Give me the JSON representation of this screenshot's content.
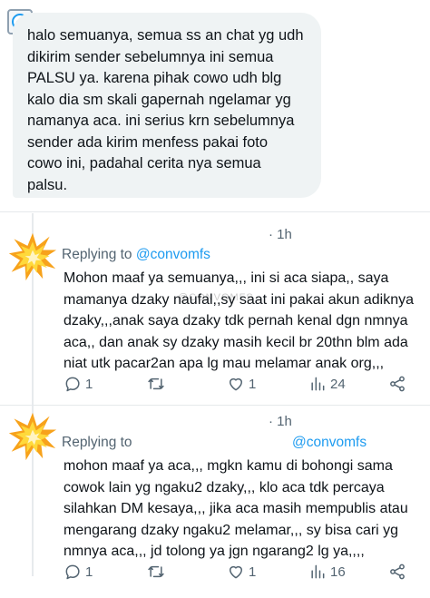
{
  "main_message": {
    "text": "halo semuanya, semua ss an chat yg udh\ndikirim sender sebelumnya ini semua\nPALSU ya. karena pihak cowo udh blg\nkalo dia sm skali gapernah ngelamar yg\nnamanya aca. ini serius krn sebelumnya\nsender ada kirim menfess pakai foto\ncowo ini, padahal cerita nya semua\npalsu."
  },
  "replies": [
    {
      "time": "· 1h",
      "replying_prefix": "Replying to ",
      "replying_handle": "@convomfs",
      "watermark": "@CONVOMFS",
      "text": "Mohon maaf ya semuanya,,, ini si aca siapa,, saya\nmamanya dzaky naufal,,sy saat ini pakai akun adiknya\ndzaky,,,anak saya dzaky tdk pernah kenal dgn nmnya\naca,, dan anak sy dzaky masih kecil br 20thn blm ada\nniat utk pacar2an apa lg mau melamar anak org,,,",
      "replies_count": "1",
      "likes_count": "1",
      "views_count": "24"
    },
    {
      "time": "· 1h",
      "replying_prefix": "Replying to",
      "replying_handle": "@convomfs",
      "text": "mohon maaf ya aca,,, mgkn kamu di bohongi sama\ncowok lain yg ngaku2 dzaky,,, klo aca tdk percaya\nsilahkan DM kesaya,,, jika aca masih mempublis atau\nmengarang dzaky ngaku2 melamar,,, sy bisa cari yg\nnmnya aca,,, jd tolong ya jgn ngarang2 lg ya,,,,",
      "replies_count": "1",
      "likes_count": "1",
      "views_count": "16"
    }
  ],
  "icons": {
    "corner": "app-badge-icon",
    "avatar": "explosion-avatar-icon",
    "reply": "reply-icon",
    "retweet": "retweet-icon",
    "like": "heart-icon",
    "views": "views-icon",
    "share": "share-icon"
  },
  "colors": {
    "bubble": "#eff3f4",
    "accent": "#1d9bf0",
    "secondary_text": "#536471"
  }
}
